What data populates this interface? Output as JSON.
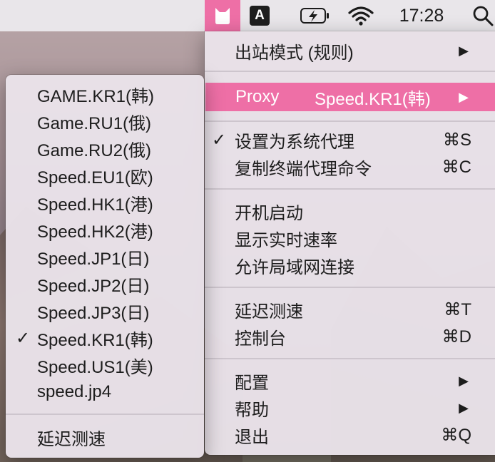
{
  "menubar": {
    "input_source": "A",
    "clock": "17:28"
  },
  "main_menu": {
    "items": [
      {
        "label": "出站模式 (规则)",
        "submenu": true
      },
      {
        "label": "Proxy",
        "value": "Speed.KR1(韩)",
        "submenu": true,
        "highlighted": true
      },
      {
        "label": "设置为系统代理",
        "shortcut": "⌘S",
        "checked": true
      },
      {
        "label": "复制终端代理命令",
        "shortcut": "⌘C"
      },
      {
        "label": "开机启动"
      },
      {
        "label": "显示实时速率"
      },
      {
        "label": "允许局域网连接"
      },
      {
        "label": "延迟测速",
        "shortcut": "⌘T"
      },
      {
        "label": "控制台",
        "shortcut": "⌘D"
      },
      {
        "label": "配置",
        "submenu": true
      },
      {
        "label": "帮助",
        "submenu": true
      },
      {
        "label": "退出",
        "shortcut": "⌘Q"
      }
    ]
  },
  "proxy_submenu": {
    "items": [
      {
        "label": "GAME.KR1(韩)"
      },
      {
        "label": "Game.RU1(俄)"
      },
      {
        "label": "Game.RU2(俄)"
      },
      {
        "label": "Speed.EU1(欧)"
      },
      {
        "label": "Speed.HK1(港)"
      },
      {
        "label": "Speed.HK2(港)"
      },
      {
        "label": "Speed.JP1(日)"
      },
      {
        "label": "Speed.JP2(日)"
      },
      {
        "label": "Speed.JP3(日)"
      },
      {
        "label": "Speed.KR1(韩)",
        "checked": true
      },
      {
        "label": "Speed.US1(美)"
      },
      {
        "label": "speed.jp4"
      },
      {
        "label": "延迟测速"
      }
    ]
  },
  "glyphs": {
    "check": "✓",
    "arrow": "▶"
  },
  "colors": {
    "highlight": "#ee6fa6",
    "menubar": "#e9e6ea",
    "menu_bg": "#e9e2e9"
  },
  "icons": [
    "clashx-cat-icon",
    "input-source-icon",
    "battery-charging-icon",
    "wifi-icon",
    "spotlight-search-icon"
  ]
}
